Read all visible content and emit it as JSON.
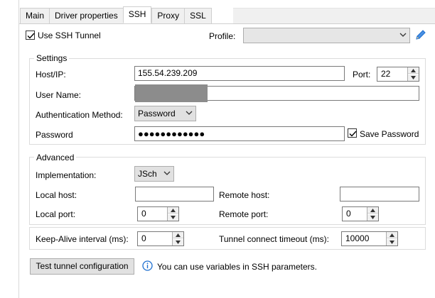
{
  "tabs": [
    {
      "label": "Main"
    },
    {
      "label": "Driver properties"
    },
    {
      "label": "SSH"
    },
    {
      "label": "Proxy"
    },
    {
      "label": "SSL"
    }
  ],
  "ssh": {
    "use_tunnel_label": "Use SSH Tunnel",
    "use_tunnel_checked": true,
    "profile_label": "Profile:",
    "profile_value": ""
  },
  "settings": {
    "title": "Settings",
    "host_label": "Host/IP:",
    "host_value": "155.54.239.209",
    "port_label": "Port:",
    "port_value": "22",
    "user_label": "User Name:",
    "auth_label": "Authentication Method:",
    "auth_value": "Password",
    "password_label": "Password",
    "password_value": "●●●●●●●●●●●●",
    "save_password_label": "Save Password",
    "save_password_checked": true
  },
  "advanced": {
    "title": "Advanced",
    "impl_label": "Implementation:",
    "impl_value": "JSch",
    "local_host_label": "Local host:",
    "local_host_value": "",
    "remote_host_label": "Remote host:",
    "remote_host_value": "",
    "local_port_label": "Local port:",
    "local_port_value": "0",
    "remote_port_label": "Remote port:",
    "remote_port_value": "0"
  },
  "timing": {
    "keepalive_label": "Keep-Alive interval (ms):",
    "keepalive_value": "0",
    "timeout_label": "Tunnel connect timeout (ms):",
    "timeout_value": "10000"
  },
  "footer": {
    "test_button": "Test tunnel configuration",
    "info_text": "You can use variables in SSH parameters."
  },
  "colors": {
    "accent": "#1e6fd0",
    "masked": "#8c8c8c"
  }
}
